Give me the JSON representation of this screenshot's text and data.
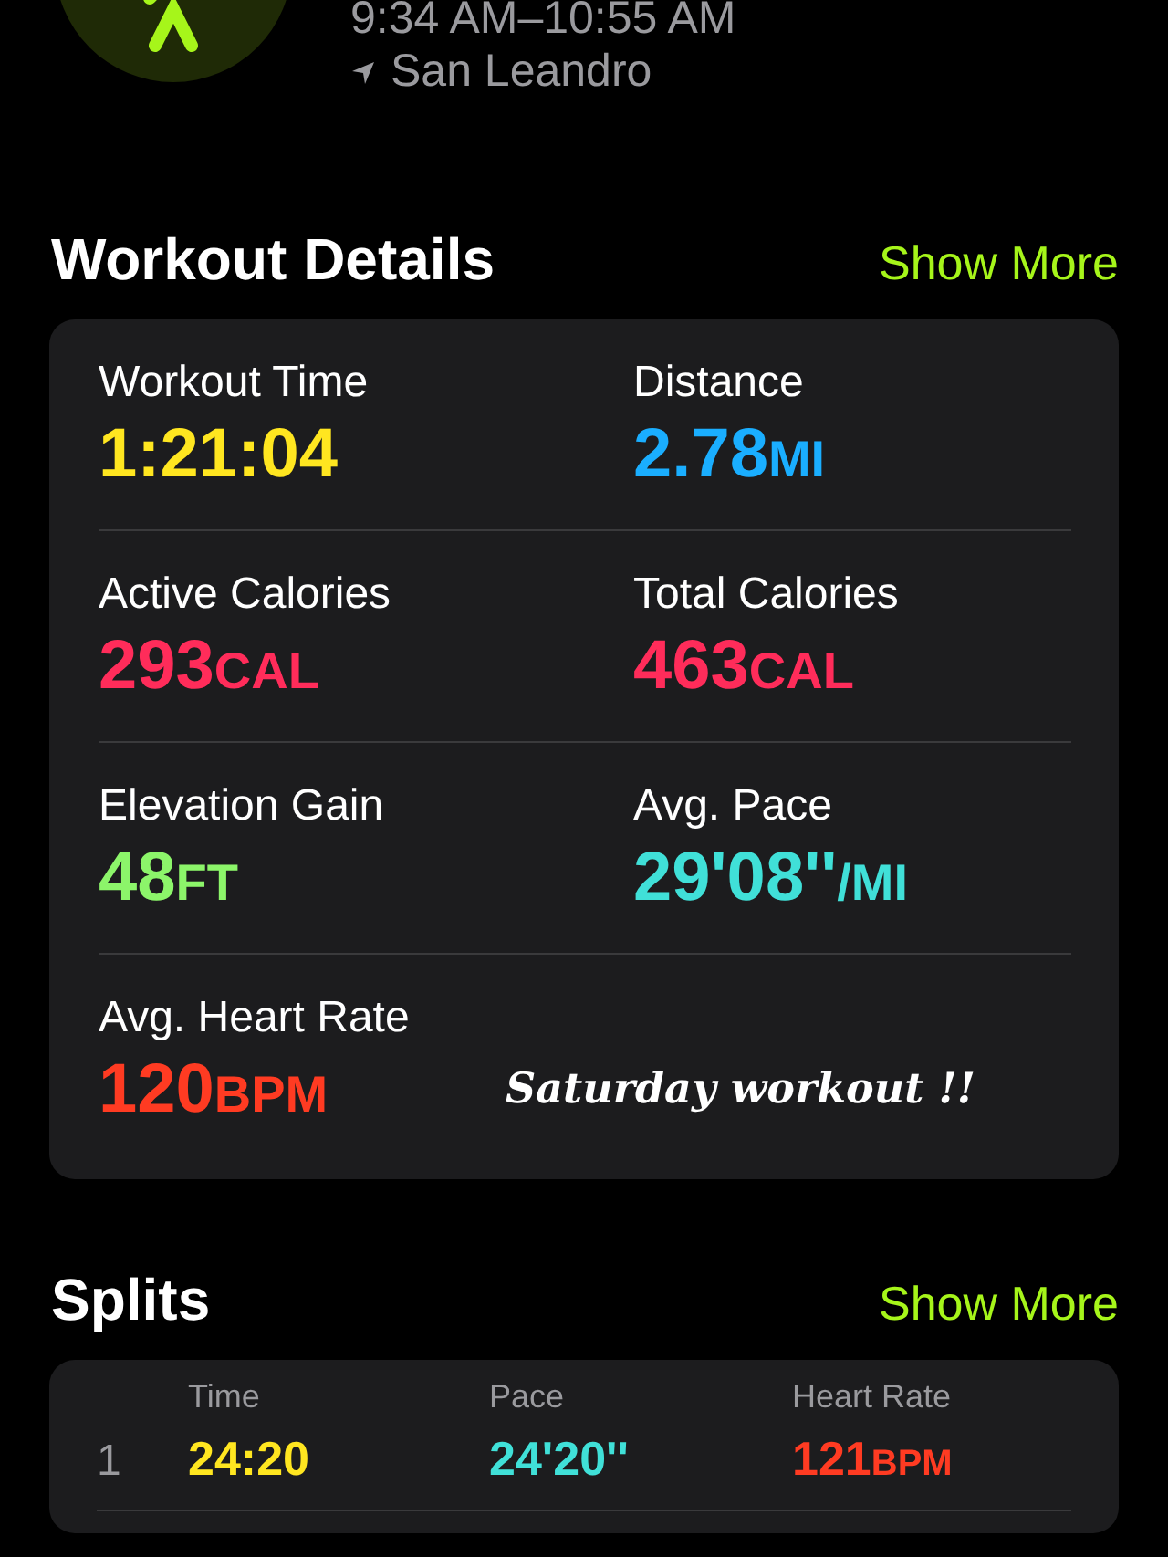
{
  "header": {
    "time_range": "9:34 AM–10:55 AM",
    "location": "San Leandro"
  },
  "workout_details": {
    "title": "Workout Details",
    "action": "Show More",
    "metrics": [
      {
        "label": "Workout Time",
        "value": "1:21:04",
        "color": "#ffe620"
      },
      {
        "label": "Distance",
        "value": "2.78",
        "unit": "MI",
        "color": "#1aaeff"
      },
      {
        "label": "Active Calories",
        "value": "293",
        "unit": "CAL",
        "color": "#ff2c5a"
      },
      {
        "label": "Total Calories",
        "value": "463",
        "unit": "CAL",
        "color": "#ff2c5a"
      },
      {
        "label": "Elevation Gain",
        "value": "48",
        "unit": "FT",
        "color": "#8cf56a"
      },
      {
        "label": "Avg. Pace",
        "value": "29'08''",
        "unit": "/MI",
        "color": "#40e0d8"
      },
      {
        "label": "Avg. Heart Rate",
        "value": "120",
        "unit": "BPM",
        "color": "#ff3b22"
      }
    ],
    "note": "Saturday workout !!"
  },
  "splits": {
    "title": "Splits",
    "action": "Show More",
    "columns": [
      "Time",
      "Pace",
      "Heart Rate"
    ],
    "rows": [
      {
        "index": "1",
        "cells": [
          {
            "value": "24:20",
            "color": "#ffe620"
          },
          {
            "value": "24'20''",
            "color": "#40e0d8"
          },
          {
            "value": "121",
            "unit": "BPM",
            "color": "#ff3b22"
          }
        ]
      }
    ]
  }
}
